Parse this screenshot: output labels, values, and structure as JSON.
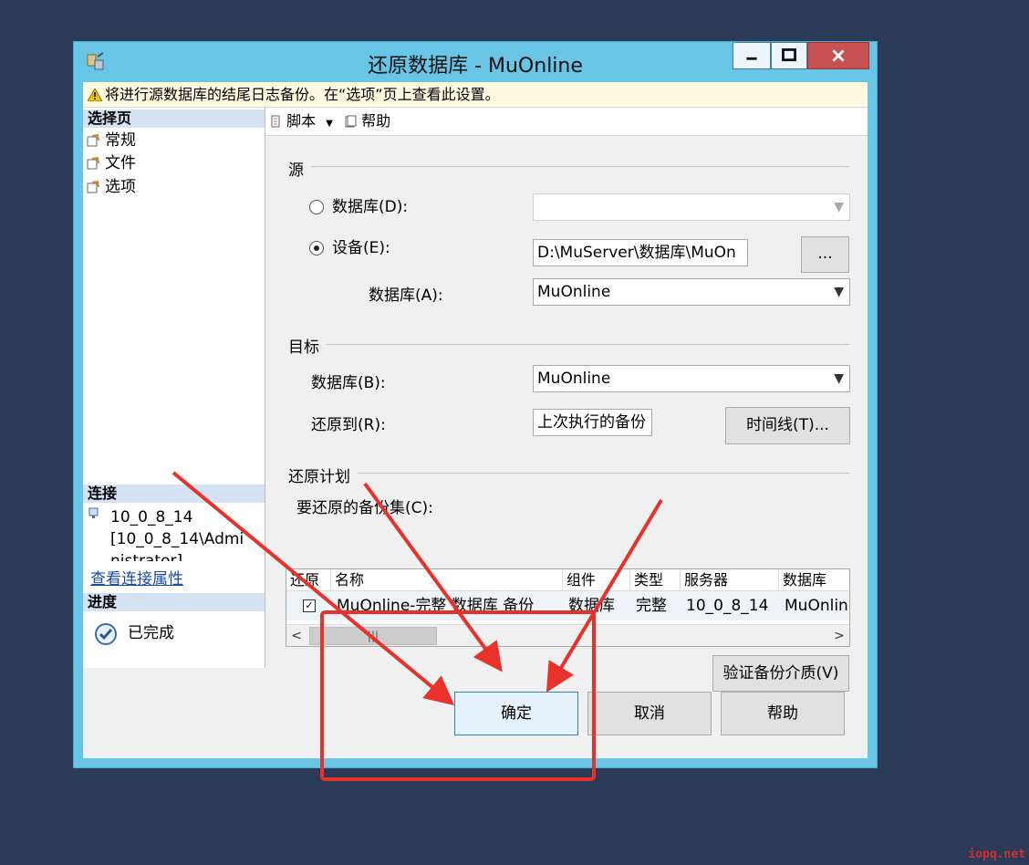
{
  "window": {
    "title": "还原数据库 - MuOnline",
    "controls": {
      "minimize": "minimize-icon",
      "maximize": "maximize-icon",
      "close": "close-icon"
    }
  },
  "warning": {
    "text": "将进行源数据库的结尾日志备份。在“选项”页上查看此设置。"
  },
  "sidebar": {
    "select_page_title": "选择页",
    "pages": [
      {
        "label": "常规"
      },
      {
        "label": "文件"
      },
      {
        "label": "选项"
      }
    ],
    "connection_title": "连接",
    "connection_lines": [
      "10_0_8_14",
      "[10_0_8_14\\Admi",
      "nistrator]"
    ],
    "view_connection_link": "查看连接属性",
    "progress_title": "进度",
    "progress_status": "已完成"
  },
  "toolbar": {
    "script": "脚本",
    "help": "帮助"
  },
  "source": {
    "group": "源",
    "database_radio": "数据库(D):",
    "device_radio": "设备(E):",
    "device_value": "D:\\MuServer\\数据库\\MuOn",
    "browse_button": "...",
    "database_label": "数据库(A):",
    "database_value": "MuOnline"
  },
  "target": {
    "group": "目标",
    "database_label": "数据库(B):",
    "database_value": "MuOnline",
    "restore_to_label": "还原到(R):",
    "restore_to_value": "上次执行的备份",
    "timeline_button": "时间线(T)..."
  },
  "plan": {
    "group": "还原计划",
    "sets_label": "要还原的备份集(C):",
    "columns": [
      "还原",
      "名称",
      "组件",
      "类型",
      "服务器",
      "数据库"
    ],
    "rows": [
      {
        "restore": "✓",
        "name": "MuOnline-完整 数据库 备份",
        "component": "数据库",
        "type": "完整",
        "server": "10_0_8_14",
        "database": "MuOnline"
      }
    ],
    "verify_button": "验证备份介质(V)"
  },
  "buttons": {
    "ok": "确定",
    "cancel": "取消",
    "help": "帮助"
  },
  "annotation": {
    "highlight_color": "#e8312a"
  },
  "watermark": "iopq.net"
}
